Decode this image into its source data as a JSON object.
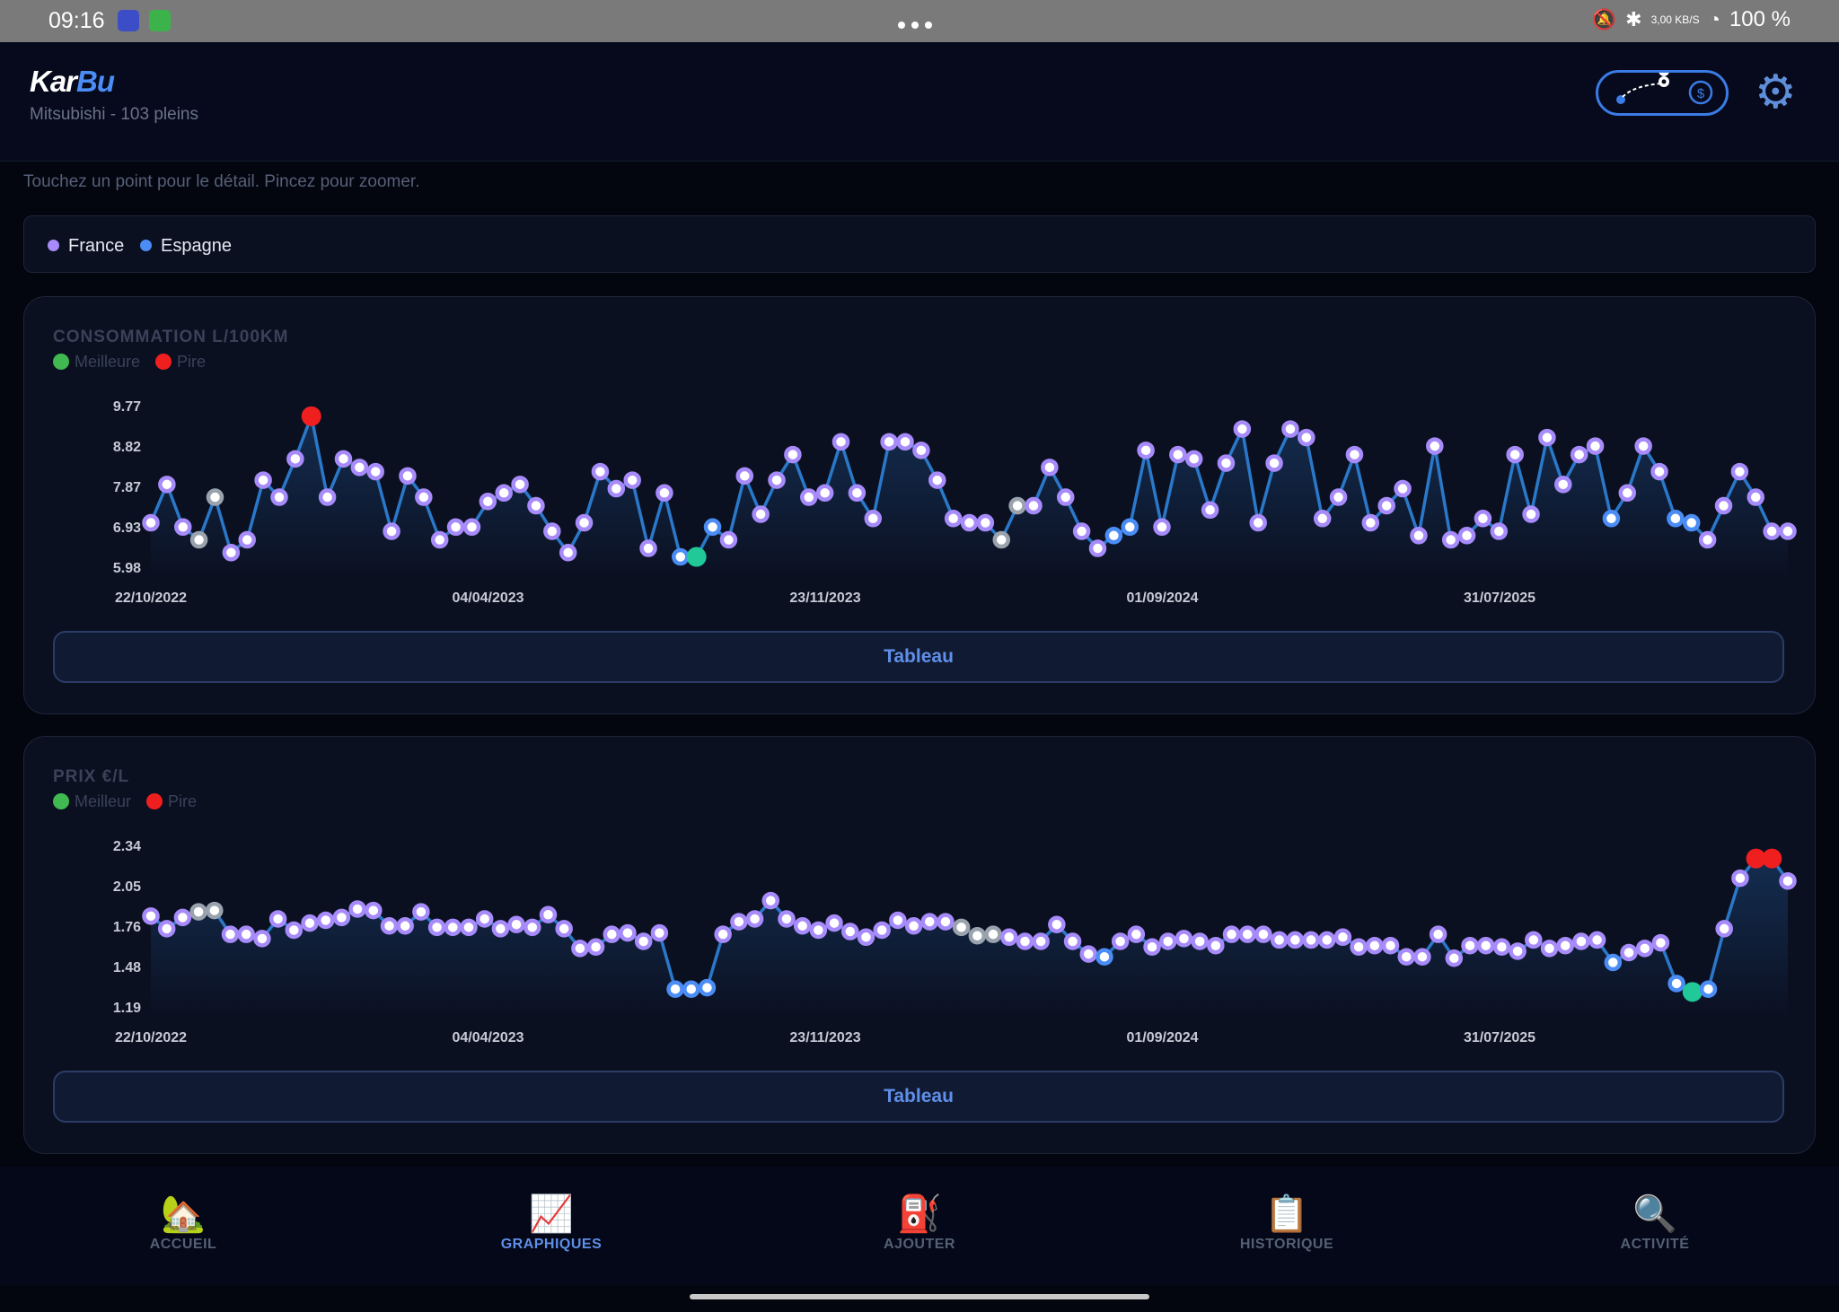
{
  "status_bar": {
    "time": "09:16",
    "speed": "3,00 KB/S",
    "battery": "100 %"
  },
  "header": {
    "app_name_part1": "Kar",
    "app_name_part2": "Bu",
    "subtitle": "Mitsubishi - 103 pleins"
  },
  "hint": "Touchez un point pour le détail. Pincez pour zoomer.",
  "country_legend": [
    {
      "label": "France",
      "color": "#a78bfa"
    },
    {
      "label": "Espagne",
      "color": "#4b8df5"
    }
  ],
  "colors": {
    "line": "#2a78c9",
    "france": "#a78bfa",
    "espagne": "#4b8df5",
    "other": "#9aa3ad",
    "best": "#20c997",
    "worst": "#ef1f1f",
    "accent": "#5f8fe8"
  },
  "consumption_card": {
    "title": "CONSOMMATION L/100KM",
    "best_label": "Meilleure",
    "worst_label": "Pire",
    "table_button": "Tableau"
  },
  "price_card": {
    "title": "PRIX €/L",
    "best_label": "Meilleur",
    "worst_label": "Pire",
    "table_button": "Tableau"
  },
  "chart_data": [
    {
      "type": "line",
      "title": "CONSOMMATION L/100KM",
      "y_ticks": [
        "9.77",
        "8.82",
        "7.87",
        "6.93",
        "5.98"
      ],
      "x_ticks": [
        "22/10/2022",
        "04/04/2023",
        "23/11/2023",
        "01/09/2024",
        "31/07/2025"
      ],
      "ylim": [
        5.98,
        9.77
      ],
      "series": [
        {
          "values": [
            7.0,
            7.9,
            6.9,
            6.6,
            7.6,
            6.3,
            6.6,
            8.0,
            7.6,
            8.5,
            9.5,
            7.6,
            8.5,
            8.3,
            8.2,
            6.8,
            8.1,
            7.6,
            6.6,
            6.9,
            6.9,
            7.5,
            7.7,
            7.9,
            7.4,
            6.8,
            6.3,
            7.0,
            8.2,
            7.8,
            8.0,
            6.4,
            7.7,
            6.2,
            6.2,
            6.9,
            6.6,
            8.1,
            7.2,
            8.0,
            8.6,
            7.6,
            7.7,
            8.9,
            7.7,
            7.1,
            8.9,
            8.9,
            8.7,
            8.0,
            7.1,
            7.0,
            7.0,
            6.6,
            7.4,
            7.4,
            8.3,
            7.6,
            6.8,
            6.4,
            6.7,
            6.9,
            8.7,
            6.9,
            8.6,
            8.5,
            7.3,
            8.4,
            9.2,
            7.0,
            8.4,
            9.2,
            9.0,
            7.1,
            7.6,
            8.6,
            7.0,
            7.4,
            7.8,
            6.7,
            8.8,
            6.6,
            6.7,
            7.1,
            6.8,
            8.6,
            7.2,
            9.0,
            7.9,
            8.6,
            8.8,
            7.1,
            7.7,
            8.8,
            8.2,
            7.1,
            7.0,
            6.6,
            7.4,
            8.2,
            7.6,
            6.8,
            6.8
          ]
        }
      ],
      "series_colors": [
        "a",
        "f",
        "f",
        "o",
        "o",
        "f",
        "f",
        "f",
        "f",
        "f",
        "w",
        "f",
        "f",
        "f",
        "f",
        "f",
        "f",
        "f",
        "f",
        "f",
        "f",
        "f",
        "f",
        "f",
        "f",
        "f",
        "f",
        "f",
        "f",
        "f",
        "f",
        "f",
        "f",
        "e",
        "b",
        "e",
        "f",
        "f",
        "f",
        "f",
        "f",
        "f",
        "f",
        "f",
        "f",
        "f",
        "f",
        "f",
        "f",
        "f",
        "f",
        "f",
        "f",
        "o",
        "o",
        "f",
        "f",
        "f",
        "f",
        "f",
        "e",
        "e",
        "f",
        "f",
        "f",
        "f",
        "f",
        "f",
        "f",
        "f",
        "f",
        "f",
        "f",
        "f",
        "f",
        "f",
        "f",
        "f",
        "f",
        "f",
        "f",
        "f",
        "f",
        "f",
        "f",
        "f",
        "f",
        "f",
        "f",
        "f",
        "f",
        "e",
        "f",
        "f",
        "f",
        "e",
        "e",
        "f",
        "f",
        "f",
        "f",
        "f",
        "f"
      ],
      "best": {
        "value": 6.2
      },
      "worst": {
        "value": 9.5
      }
    },
    {
      "type": "line",
      "title": "PRIX €/L",
      "y_ticks": [
        "2.34",
        "2.05",
        "1.76",
        "1.48",
        "1.19"
      ],
      "x_ticks": [
        "22/10/2022",
        "04/04/2023",
        "23/11/2023",
        "01/09/2024",
        "31/07/2025"
      ],
      "ylim": [
        1.19,
        2.34
      ],
      "series": [
        {
          "values": [
            1.83,
            1.74,
            1.82,
            1.86,
            1.87,
            1.7,
            1.7,
            1.67,
            1.81,
            1.73,
            1.78,
            1.8,
            1.82,
            1.88,
            1.87,
            1.76,
            1.76,
            1.86,
            1.75,
            1.75,
            1.75,
            1.81,
            1.74,
            1.77,
            1.75,
            1.84,
            1.74,
            1.6,
            1.61,
            1.7,
            1.71,
            1.65,
            1.71,
            1.31,
            1.31,
            1.32,
            1.7,
            1.79,
            1.81,
            1.94,
            1.81,
            1.76,
            1.73,
            1.78,
            1.72,
            1.68,
            1.73,
            1.8,
            1.76,
            1.79,
            1.79,
            1.75,
            1.69,
            1.7,
            1.68,
            1.65,
            1.65,
            1.77,
            1.65,
            1.56,
            1.54,
            1.65,
            1.7,
            1.61,
            1.65,
            1.67,
            1.65,
            1.62,
            1.7,
            1.7,
            1.7,
            1.66,
            1.66,
            1.66,
            1.66,
            1.68,
            1.61,
            1.62,
            1.62,
            1.54,
            1.54,
            1.7,
            1.53,
            1.62,
            1.62,
            1.61,
            1.58,
            1.66,
            1.6,
            1.62,
            1.65,
            1.66,
            1.5,
            1.57,
            1.6,
            1.64,
            1.35,
            1.29,
            1.31,
            1.74,
            2.1,
            2.24,
            2.24,
            2.08
          ]
        }
      ],
      "series_colors": [
        "a",
        "f",
        "f",
        "o",
        "o",
        "f",
        "f",
        "f",
        "f",
        "f",
        "f",
        "f",
        "f",
        "f",
        "f",
        "f",
        "f",
        "f",
        "f",
        "f",
        "f",
        "f",
        "f",
        "f",
        "f",
        "f",
        "f",
        "f",
        "f",
        "f",
        "f",
        "f",
        "f",
        "e",
        "e",
        "e",
        "f",
        "f",
        "f",
        "f",
        "f",
        "f",
        "f",
        "f",
        "f",
        "f",
        "f",
        "f",
        "f",
        "f",
        "f",
        "o",
        "o",
        "o",
        "f",
        "f",
        "f",
        "f",
        "f",
        "f",
        "e",
        "f",
        "f",
        "f",
        "f",
        "f",
        "f",
        "f",
        "f",
        "f",
        "f",
        "f",
        "f",
        "f",
        "f",
        "f",
        "f",
        "f",
        "f",
        "f",
        "f",
        "f",
        "f",
        "f",
        "f",
        "f",
        "f",
        "f",
        "f",
        "f",
        "f",
        "f",
        "e",
        "f",
        "f",
        "f",
        "e",
        "b",
        "e",
        "f",
        "f",
        "w",
        "w",
        "f"
      ],
      "best": {
        "value": 1.29
      },
      "worst": {
        "value": 2.24
      }
    }
  ],
  "bottom_nav": [
    {
      "icon": "home-icon",
      "label": "ACCUEIL",
      "glyph": "🏡"
    },
    {
      "icon": "chart-icon",
      "label": "GRAPHIQUES",
      "glyph": "📈"
    },
    {
      "icon": "fuel-pump-icon",
      "label": "AJOUTER",
      "glyph": "⛽"
    },
    {
      "icon": "clipboard-icon",
      "label": "HISTORIQUE",
      "glyph": "📋"
    },
    {
      "icon": "magnifier-icon",
      "label": "ACTIVITÉ",
      "glyph": "🔍"
    }
  ]
}
